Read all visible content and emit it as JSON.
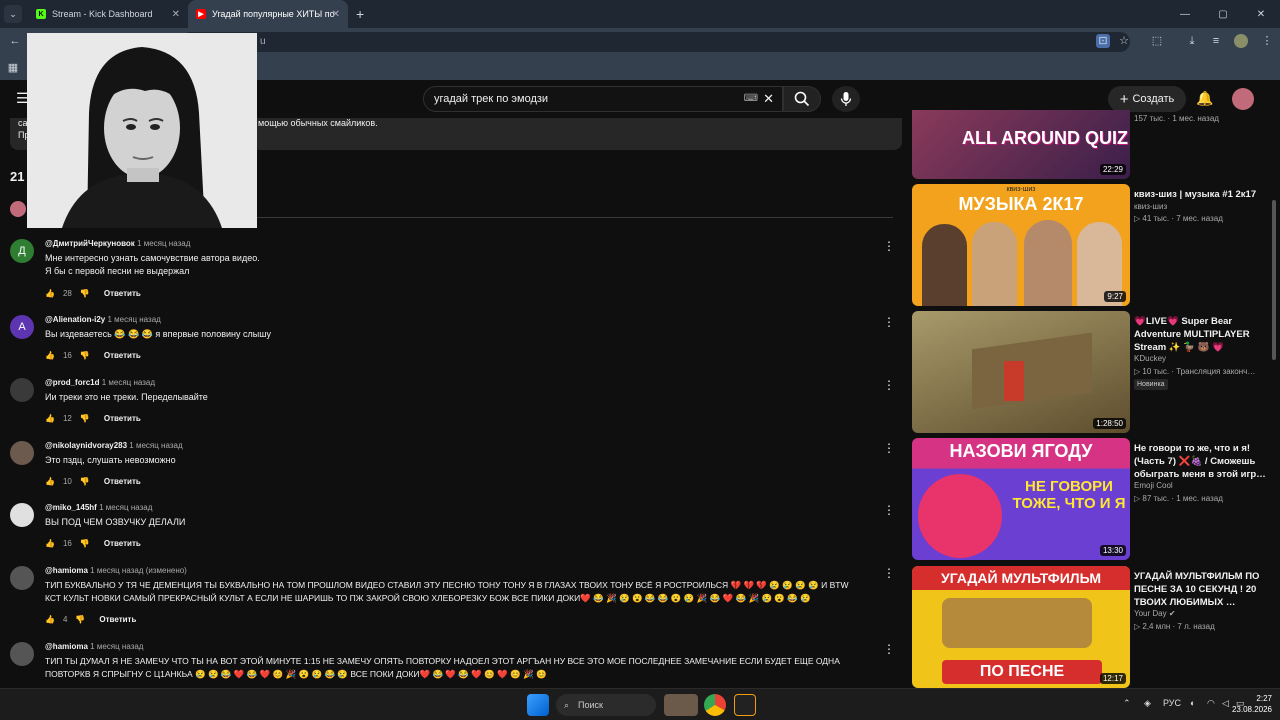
{
  "browser": {
    "tabs": [
      {
        "title": "Stream - Kick Dashboard"
      },
      {
        "title": "Угадай популярные ХИТЫ по"
      }
    ],
    "address_fragment": "u"
  },
  "youtube": {
    "search_query": "угадай трек по эмодзи",
    "create_label": "Создать",
    "description_line1_start": "са",
    "description_line1_end": "мощью обычных смайликов.",
    "description_line2": "Пр",
    "comments_count_partial": "21"
  },
  "comments": [
    {
      "author": "@ДмитрийЧеркуновок",
      "time": "1 месяц назад",
      "avatar_letter": "Д",
      "avatar_color": "#2e7d32",
      "lines": [
        "Мне интересно узнать самочувствие автора видео.",
        "Я бы с первой песни не выдержал"
      ],
      "likes": "28",
      "reply": "Ответить"
    },
    {
      "author": "@Alienation-i2y",
      "time": "1 месяц назад",
      "avatar_letter": "A",
      "avatar_color": "#5e35b1",
      "lines": [
        "Вы издеваетесь 😂 😂 😂 я впервые половину слышу"
      ],
      "likes": "16",
      "reply": "Ответить"
    },
    {
      "author": "@prod_forc1d",
      "time": "1 месяц назад",
      "avatar_letter": "",
      "avatar_color": "#3a3a3a",
      "lines": [
        "Ии треки это не треки. Переделывайте"
      ],
      "likes": "12",
      "reply": "Ответить"
    },
    {
      "author": "@nikolaynidvoray283",
      "time": "1 месяц назад",
      "avatar_letter": "",
      "avatar_color": "#6d5a4e",
      "lines": [
        "Это пздц, слушать невозможно"
      ],
      "likes": "10",
      "reply": "Ответить"
    },
    {
      "author": "@miko_145hf",
      "time": "1 месяц назад",
      "avatar_letter": "",
      "avatar_color": "#e0e0e0",
      "lines": [
        "ВЫ ПОД ЧЕМ ОЗВУЧКУ ДЕЛАЛИ"
      ],
      "likes": "16",
      "reply": "Ответить"
    },
    {
      "author": "@hamioma",
      "time": "1 месяц назад (изменено)",
      "avatar_letter": "",
      "avatar_color": "#555",
      "lines": [
        "ТИП БУКВАЛЬНО У ТЯ ЧЕ ДЕМЕНЦИЯ ТЫ БУКВАЛЬНО НА ТОМ ПРОШЛОМ ВИДЕО СТАВИЛ ЭТУ ПЕСНЮ ТОНУ ТОНУ Я В ГЛАЗАХ ТВОИХ ТОНУ ВСЁ Я РОСТРОИЛЬСЯ 💔 💔 💔 😢 😢 😢 😢 И BTW",
        "КСТ КУЛЬТ НОВКИ САМЫЙ ПРЕКРАСНЫЙ КУЛЬТ А ЕСЛИ НЕ ШАРИШЬ ТО ПЖ ЗАКРОЙ СВОЮ ХЛЕБОРЕЗКУ БОЖ ВСЕ ПИКИ ДОКИ❤️ 😂 🎉 😢 😮 😂 😂 😮 😢 🎉 😂 ❤️ 😂 🎉 😢 😮 😂 😢"
      ],
      "likes": "4",
      "reply": "Ответить"
    },
    {
      "author": "@hamioma",
      "time": "1 месяц назад",
      "avatar_letter": "",
      "avatar_color": "#555",
      "lines": [
        "ТИП ТЫ ДУМАЛ Я НЕ ЗАМЕЧУ ЧТО ТЫ НА ВОТ ЭТОЙ МИНУТЕ 1:15 НЕ ЗАМЕЧУ ОПЯТЬ ПОВТОРКУ НАДОЕЛ ЭТОТ АРГЪАН НУ ВСЕ ЭТО МОЕ ПОСЛЕДНЕЕ ЗАМЕЧАНИЕ ЕСЛИ БУДЕТ ЕЩЕ ОДНА",
        "ПОВТОРКВ Я СПРЫГНУ С Ц1АНКЬА 😢 😢 😂 ❤️ 😂 ❤️ 😊 🎉 😮 😢 😂 😢 ВСЕ ПОКИ ДОКИ❤️ 😂 ❤️ 😂 ❤️ 😊 ❤️ 😊 🎉 😊"
      ],
      "likes": "",
      "reply": ""
    }
  ],
  "sidebar": [
    {
      "thumb_text": "ALL AROUND QUIZ",
      "duration": "22:29",
      "title": "",
      "channel": "",
      "meta": "157 тыс. · 1 мес. назад",
      "badge": "",
      "thumb_bg": "#6a2f4f"
    },
    {
      "thumb_text": "МУЗЫКА 2К17",
      "thumb_sub": "квиз-шиз",
      "duration": "9:27",
      "title": "квиз-шиз | музыка #1 2к17",
      "channel": "квиз-шиз",
      "meta": "▷ 41 тыс. · 7 мес. назад",
      "badge": "",
      "thumb_bg": "#f2a21c"
    },
    {
      "thumb_text": "",
      "duration": "1:28:50",
      "title": "💗LIVE💗 Super Bear Adventure MULTIPLAYER Stream ✨ 🦆 🐻 💗",
      "channel": "KDuckey",
      "meta": "▷ 10 тыс. · Трансляция законч…",
      "badge": "Новинка",
      "thumb_bg": "#8b7a4a"
    },
    {
      "thumb_text": "НАЗОВИ ЯГОДУ",
      "thumb_sub": "НЕ ГОВОРИ ТОЖЕ, ЧТО И Я",
      "duration": "13:30",
      "title": "Не говори то же, что и я! (Часть 7) ❌🍇 / Сможешь обыграть меня в этой игр…",
      "channel": "Emoji Cool",
      "meta": "▷ 87 тыс. · 1 мес. назад",
      "badge": "",
      "thumb_bg": "#7a3fd1"
    },
    {
      "thumb_text": "УГАДАЙ МУЛЬТФИЛЬМ",
      "thumb_sub": "ПО ПЕСНЕ",
      "duration": "12:17",
      "title": "УГАДАЙ МУЛЬТФИЛЬМ ПО ПЕСНЕ ЗА 10 СЕКУНД ! 20 ТВОИХ ЛЮБИМЫХ …",
      "channel": "Your Day ✔",
      "meta": "▷ 2,4 млн · 7 л. назад",
      "badge": "",
      "thumb_bg": "#f0c419"
    }
  ],
  "taskbar": {
    "search_label": "Поиск",
    "lang": "РУС",
    "time": "2:27",
    "date": "23.08.2026"
  }
}
